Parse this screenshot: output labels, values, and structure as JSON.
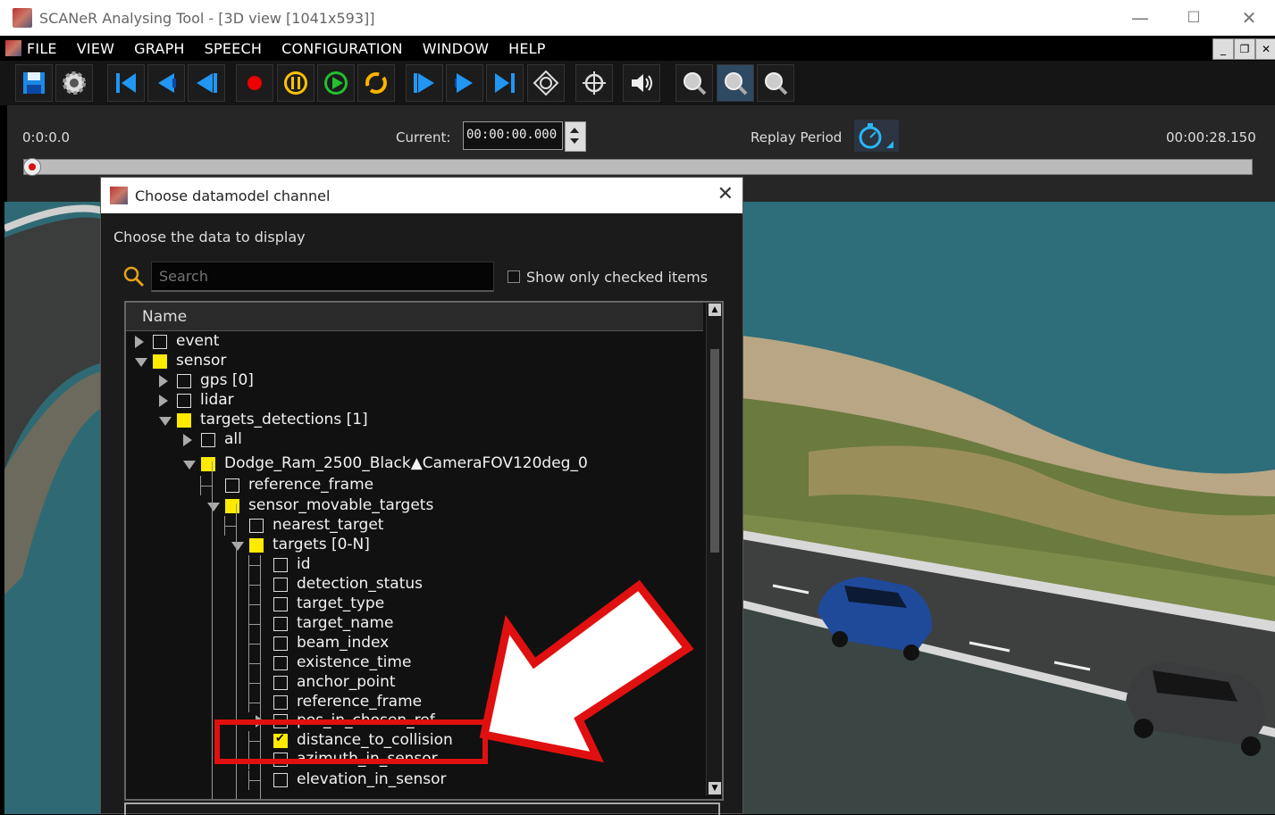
{
  "window": {
    "title": "SCANeR Analysing Tool - [3D view [1041x593]]"
  },
  "window_controls": {
    "minimize": "—",
    "maximize": "☐",
    "close": "✕"
  },
  "menu": [
    "FILE",
    "VIEW",
    "GRAPH",
    "SPEECH",
    "CONFIGURATION",
    "WINDOW",
    "HELP"
  ],
  "mdi_controls": {
    "minimize": "_",
    "restore": "❐",
    "close": "✕"
  },
  "toolbar": {
    "buttons": [
      "save-icon",
      "settings-gear-icon",
      "jump-to-start-icon",
      "step-back-icon",
      "rewind-icon",
      "record-icon",
      "pause-icon",
      "play-icon",
      "loop-icon",
      "forward-icon",
      "step-forward-icon",
      "jump-to-end-icon",
      "camera-orbit-icon",
      "crosshair-icon",
      "sound-icon",
      "zoom-icon-1",
      "zoom-icon-2",
      "zoom-icon-3"
    ]
  },
  "timeline": {
    "start_time": "0:0:0.0",
    "current_label": "Current:",
    "current_value": "00:00:00.000",
    "replay_label": "Replay Period",
    "end_time": "00:00:28.150",
    "progress": 0.0
  },
  "dialog": {
    "title": "Choose datamodel channel",
    "close": "✕",
    "prompt": "Choose the data to display",
    "search_placeholder": "Search",
    "show_only_checked": "Show only checked items",
    "column_name": "Name",
    "tree": [
      {
        "label": "event",
        "depth": 0,
        "expander": "closed",
        "state": "unchecked"
      },
      {
        "label": "sensor",
        "depth": 0,
        "expander": "open",
        "state": "partial"
      },
      {
        "label": "gps [0]",
        "depth": 1,
        "expander": "closed",
        "state": "unchecked"
      },
      {
        "label": "lidar",
        "depth": 1,
        "expander": "closed",
        "state": "unchecked"
      },
      {
        "label": "targets_detections [1]",
        "depth": 1,
        "expander": "open",
        "state": "partial"
      },
      {
        "label": "all",
        "depth": 2,
        "expander": "closed",
        "state": "unchecked"
      },
      {
        "label": "Dodge_Ram_2500_Black▲CameraFOV120deg_0",
        "depth": 2,
        "expander": "open",
        "state": "partial"
      },
      {
        "label": "reference_frame",
        "depth": 3,
        "expander": "none",
        "state": "unchecked"
      },
      {
        "label": "sensor_movable_targets",
        "depth": 3,
        "expander": "open",
        "state": "partial"
      },
      {
        "label": "nearest_target",
        "depth": 4,
        "expander": "none",
        "state": "unchecked"
      },
      {
        "label": "targets [0-N]",
        "depth": 4,
        "expander": "open",
        "state": "partial"
      },
      {
        "label": "id",
        "depth": 5,
        "expander": "none",
        "state": "unchecked"
      },
      {
        "label": "detection_status",
        "depth": 5,
        "expander": "none",
        "state": "unchecked"
      },
      {
        "label": "target_type",
        "depth": 5,
        "expander": "none",
        "state": "unchecked"
      },
      {
        "label": "target_name",
        "depth": 5,
        "expander": "none",
        "state": "unchecked"
      },
      {
        "label": "beam_index",
        "depth": 5,
        "expander": "none",
        "state": "unchecked"
      },
      {
        "label": "existence_time",
        "depth": 5,
        "expander": "none",
        "state": "unchecked"
      },
      {
        "label": "anchor_point",
        "depth": 5,
        "expander": "none",
        "state": "unchecked"
      },
      {
        "label": "reference_frame",
        "depth": 5,
        "expander": "none",
        "state": "unchecked"
      },
      {
        "label": "pos_in_chosen_ref",
        "depth": 5,
        "expander": "closed",
        "state": "unchecked"
      },
      {
        "label": "distance_to_collision",
        "depth": 5,
        "expander": "none",
        "state": "checked"
      },
      {
        "label": "azimuth_in_sensor",
        "depth": 5,
        "expander": "none",
        "state": "unchecked"
      },
      {
        "label": "elevation_in_sensor",
        "depth": 5,
        "expander": "none",
        "state": "unchecked"
      }
    ]
  },
  "annotation": {
    "color": "#e01010"
  }
}
